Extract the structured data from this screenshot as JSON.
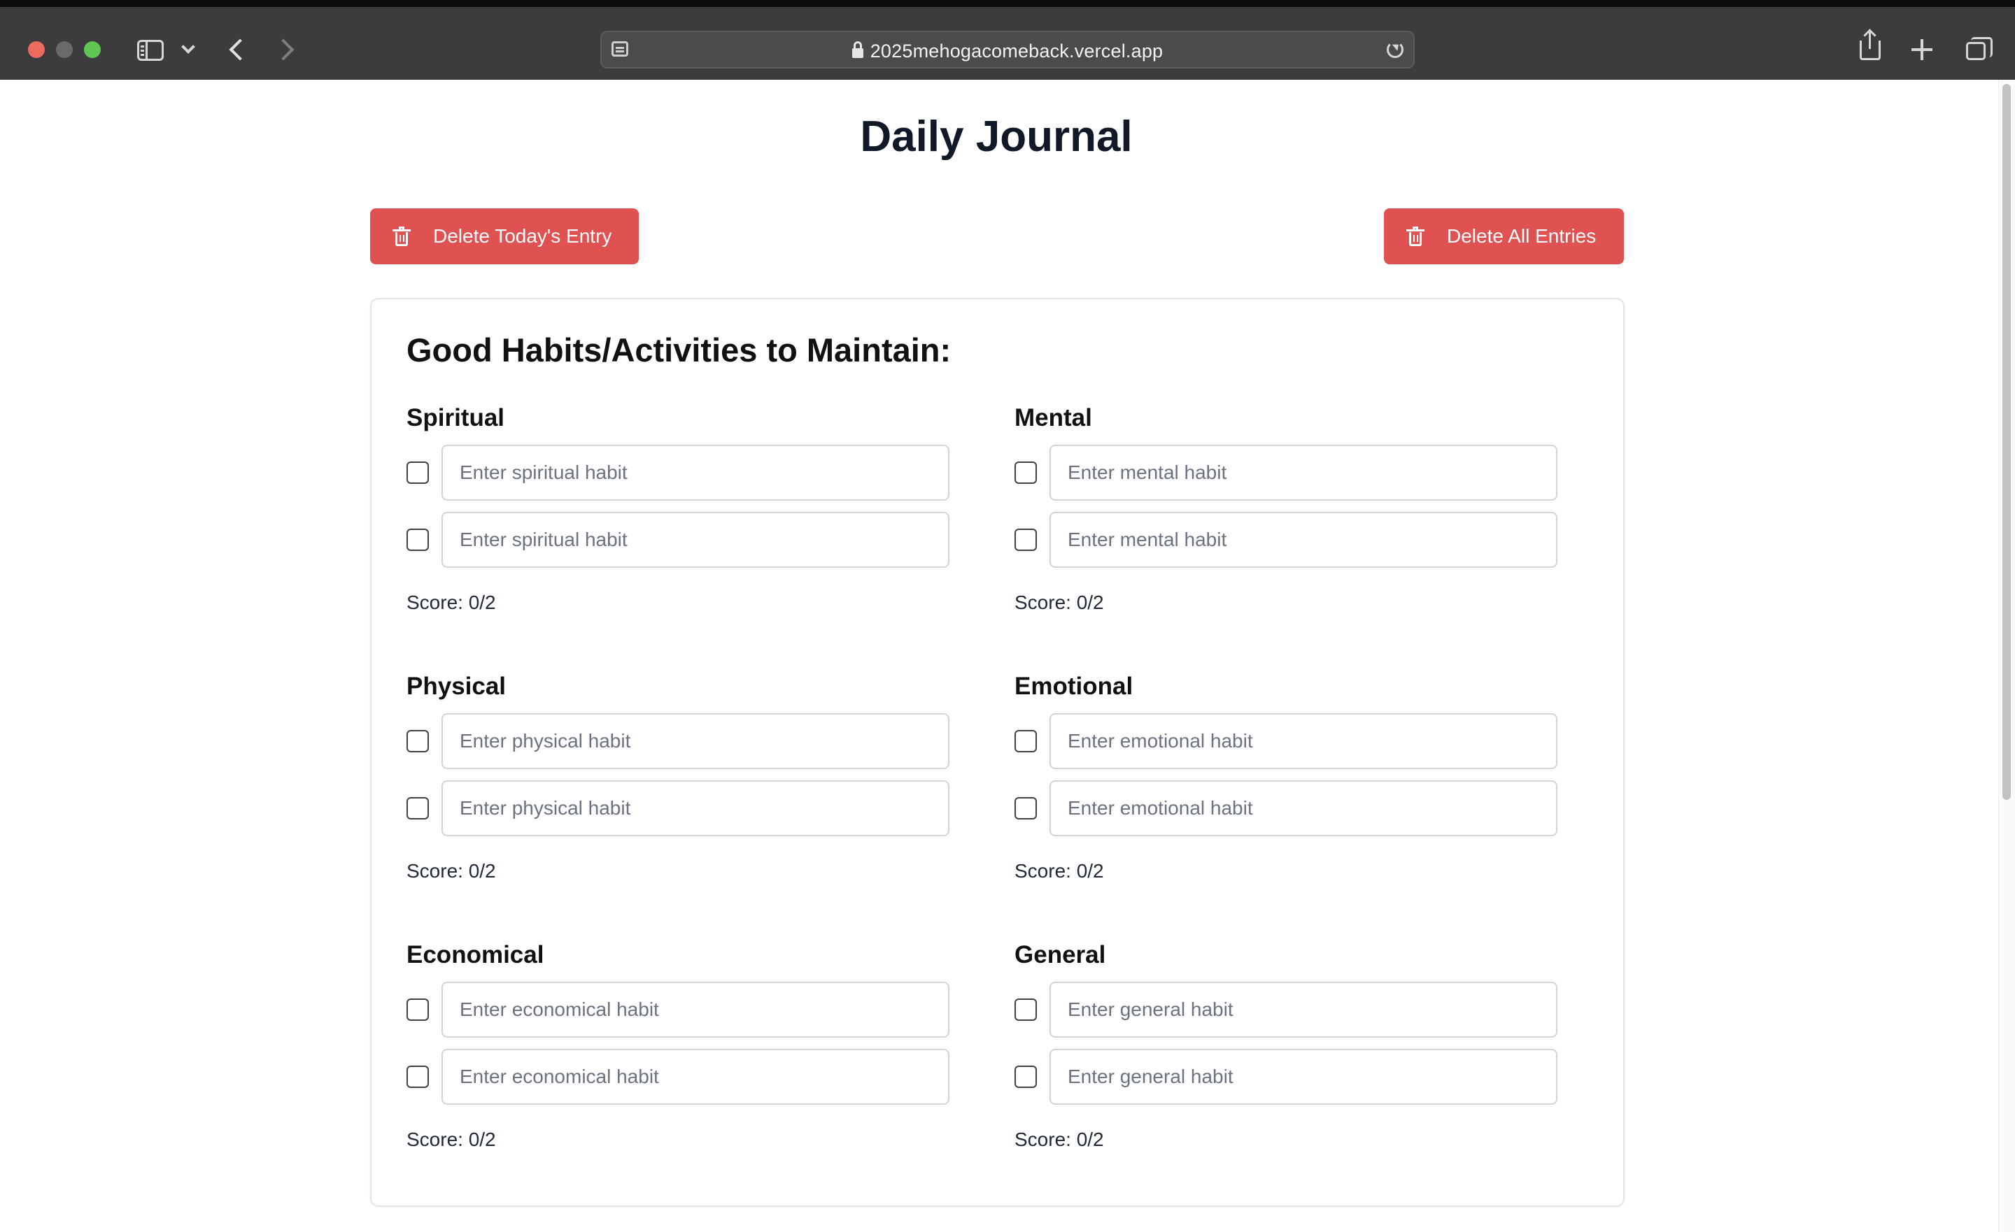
{
  "browser": {
    "url": "2025mehogacomeback.vercel.app"
  },
  "page": {
    "title": "Daily Journal",
    "delete_today_label": "Delete Today's Entry",
    "delete_all_label": "Delete All Entries"
  },
  "habits": {
    "heading": "Good Habits/Activities to Maintain:",
    "spiritual": {
      "title": "Spiritual",
      "placeholder": "Enter spiritual habit",
      "score": "Score: 0/2"
    },
    "mental": {
      "title": "Mental",
      "placeholder": "Enter mental habit",
      "score": "Score: 0/2"
    },
    "physical": {
      "title": "Physical",
      "placeholder": "Enter physical habit",
      "score": "Score: 0/2"
    },
    "emotional": {
      "title": "Emotional",
      "placeholder": "Enter emotional habit",
      "score": "Score: 0/2"
    },
    "economical": {
      "title": "Economical",
      "placeholder": "Enter economical habit",
      "score": "Score: 0/2"
    },
    "general": {
      "title": "General",
      "placeholder": "Enter general habit",
      "score": "Score: 0/2"
    }
  },
  "colors": {
    "danger": "#e05252",
    "chrome": "#3c3c3e"
  },
  "icons": [
    "sidebar-icon",
    "chevron-down-icon",
    "back-arrow-icon",
    "forward-arrow-icon",
    "reader-icon",
    "lock-icon",
    "reload-icon",
    "share-icon",
    "plus-icon",
    "tabs-icon",
    "trash-icon"
  ]
}
